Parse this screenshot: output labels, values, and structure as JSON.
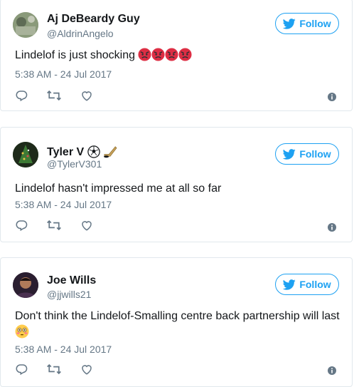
{
  "tweets": [
    {
      "name": "Aj DeBeardy Guy",
      "handle": "@AldrinAngelo",
      "text": "Lindelof is just shocking",
      "emojis": [
        "angry-face",
        "angry-face",
        "angry-face",
        "angry-face"
      ],
      "timestamp": "5:38 AM - 24 Jul 2017",
      "follow_label": "Follow",
      "avatar_color": "#7a8a6b"
    },
    {
      "name": "Tyler V",
      "name_emojis": [
        "soccer-ball",
        "hockey-stick"
      ],
      "handle": "@TylerV301",
      "text": "Lindelof hasn't impressed me at all so far",
      "timestamp": "5:38 AM - 24 Jul 2017",
      "follow_label": "Follow",
      "avatar_color": "#2f5a2a"
    },
    {
      "name": "Joe Wills",
      "handle": "@jjwills21",
      "text": "Don't think the Lindelof-Smalling centre back partnership will last",
      "emojis": [
        "flushed-face"
      ],
      "timestamp": "5:38 AM - 24 Jul 2017",
      "follow_label": "Follow",
      "avatar_color": "#3a2a3e"
    }
  ],
  "colors": {
    "accent": "#1da1f2",
    "muted": "#657786",
    "border": "#e1e8ed",
    "text": "#14171a"
  }
}
